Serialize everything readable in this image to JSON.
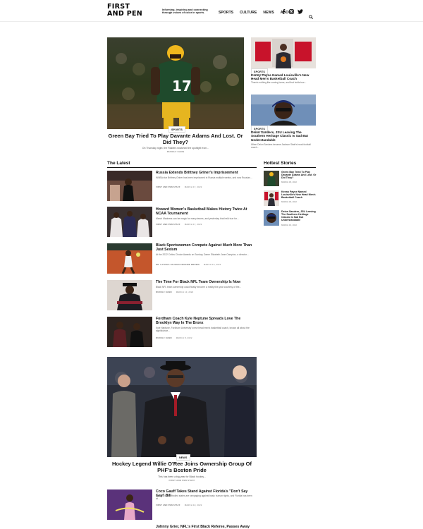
{
  "header": {
    "logo_line1": "FIRST",
    "logo_line2": "AND PEN",
    "tagline": "Informing, inspiring and connecting through voices of color in sports.",
    "nav": [
      "SPORTS",
      "CULTURE",
      "NEWS",
      "ABOUT"
    ],
    "social_icons": [
      "facebook-icon",
      "instagram-icon",
      "twitter-icon"
    ],
    "search_icon": "search-icon"
  },
  "hero": {
    "category": "SPORTS",
    "title": "Green Bay Tried To Play Davante Adams And Lost. Or Did They?",
    "excerpt": "On Thursday night, the Raiders snatched the spotlight from...",
    "author": "RUDOLF KANN"
  },
  "side_features": [
    {
      "category": "SPORTS",
      "title": "Kenny Payne Named Louisville's New Head Men's Basketball Coach",
      "excerpt": "There's nothing like coming home, and that holds true..."
    },
    {
      "category": "SPORTS",
      "title": "Deion Sanders, JSU Leaving The Southern Heritage Classic Is Sad But Understandable",
      "excerpt": "When Deion Sanders became Jackson State's head football coach..."
    }
  ],
  "latest": {
    "heading": "The Latest",
    "items": [
      {
        "title": "Russia Extends Brittney Griner's Imprisonment",
        "excerpt": "WNBA star Brittney Griner has been imprisoned in Russia multiple weeks, and now Russian...",
        "author": "FIRST AND PEN STAFF",
        "date": "MARCH 17, 2022"
      },
      {
        "title": "Howard Women's Basketball Makes History Twice At NCAA Tournament",
        "excerpt": "March Madness can be magic for many teams, and yesterday that held true for...",
        "author": "FIRST AND PEN STAFF",
        "date": "MARCH 17, 2022"
      },
      {
        "title": "Black Sportswomen Compete Against Much More Than Just Sexism",
        "excerpt": "At the 2022 Critics Choice Awards on Sunday, Dame Elizabeth Jane Campion, a director...",
        "author": "DR. LATISHA VAUGHN-CROSBIE BROWN",
        "date": "MARCH 15, 2022"
      },
      {
        "title": "The Time For Black NFL Team Ownership Is Now",
        "excerpt": "Black NFL team ownership could finally become a reality this year courtesy of the...",
        "author": "RUDOLF KANN",
        "date": "MARCH 10, 2022"
      },
      {
        "title": "Fordham Coach Kyle Neptune Spreads Love The Brooklyn Way In The Bronx",
        "excerpt": "Kyle Neptune, Fordham University's new head men's basketball coach, knows all about the significance...",
        "author": "RUDOLF KANN",
        "date": "MARCH 8, 2022"
      }
    ]
  },
  "hottest": {
    "heading": "Hottest Stories",
    "items": [
      {
        "title": "Green Bay Tried To Play Davante Adams And Lost. Or Did They?",
        "date": "MARCH 18, 2022"
      },
      {
        "title": "Kenny Payne Named Louisville's New Head Men's Basketball Coach",
        "date": "MARCH 18, 2022"
      },
      {
        "title": "Deion Sanders, JSU Leaving The Southern Heritage Classic Is Sad But Understandable",
        "date": "MARCH 16, 2022"
      }
    ]
  },
  "big_feature": {
    "category": "NEWS",
    "title": "Hockey Legend Willie O'Ree Joins Ownership Group Of PHF's Boston Pride",
    "excerpt": "This has been a big year for Black hockey...",
    "author": "FIRST AND PEN STAFF"
  },
  "second_list": [
    {
      "title": "Coco Gauff Takes Stand Against Florida's \"Don't Say Gay\" Bill",
      "excerpt": "Republican-controlled states are rampaging against basic human rights, and Florida has been at...",
      "author": "FIRST AND PEN STAFF",
      "date": "MARCH 10, 2022"
    },
    {
      "title": "Johnny Grier, NFL's First Black Referee, Passes Away"
    }
  ]
}
